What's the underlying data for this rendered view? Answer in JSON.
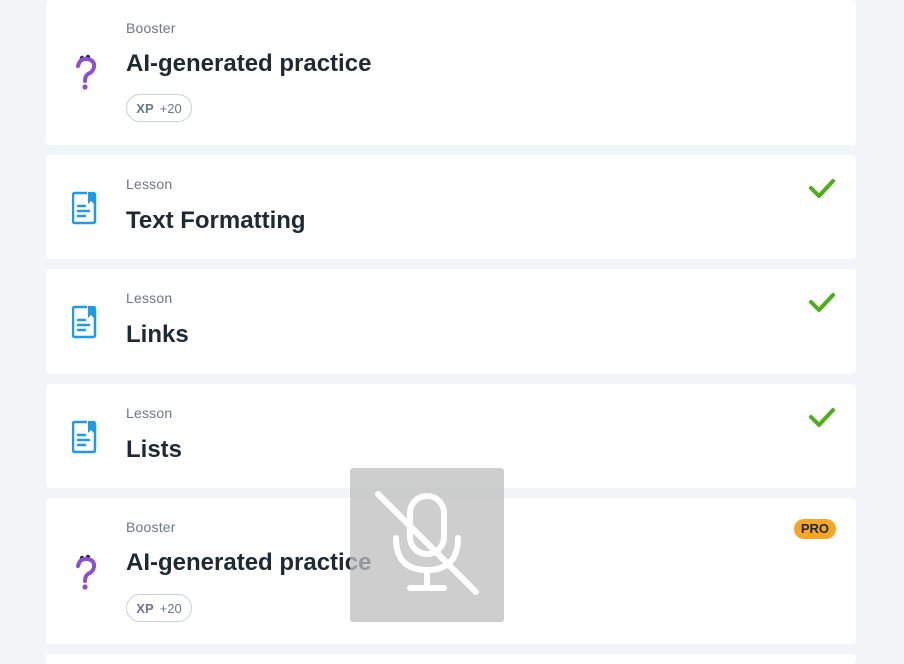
{
  "cards": [
    {
      "kind": "Booster",
      "title": "AI-generated practice",
      "xp_label": "XP",
      "xp_value": "+20",
      "icon": "question-mark-icon",
      "status": "none"
    },
    {
      "kind": "Lesson",
      "title": "Text Formatting",
      "icon": "lesson-document-icon",
      "status": "completed"
    },
    {
      "kind": "Lesson",
      "title": "Links",
      "icon": "lesson-document-icon",
      "status": "completed"
    },
    {
      "kind": "Lesson",
      "title": "Lists",
      "icon": "lesson-document-icon",
      "status": "completed"
    },
    {
      "kind": "Booster",
      "title": "AI-generated practice",
      "xp_label": "XP",
      "xp_value": "+20",
      "icon": "question-mark-icon",
      "badge": "PRO"
    }
  ],
  "overlay": {
    "icon": "microphone-muted-icon"
  },
  "colors": {
    "background": "#f2f5f7",
    "card": "#ffffff",
    "lesson_icon": "#1e9be8",
    "booster_icon": "#8a4fd6",
    "check": "#4caf1a",
    "pro_badge": "#f5a623"
  }
}
